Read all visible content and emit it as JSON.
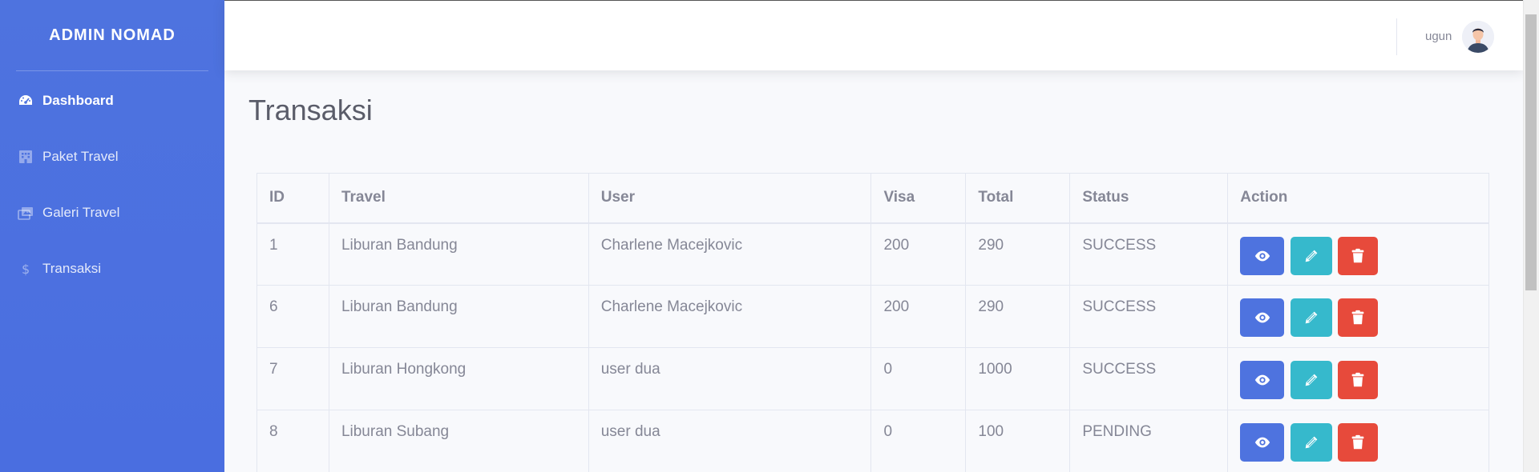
{
  "sidebar": {
    "brand": "ADMIN NOMAD",
    "items": [
      {
        "label": "Dashboard",
        "icon": "tachometer-icon",
        "active": true
      },
      {
        "label": "Paket Travel",
        "icon": "hotel-icon",
        "active": false
      },
      {
        "label": "Galeri Travel",
        "icon": "images-icon",
        "active": false
      },
      {
        "label": "Transaksi",
        "icon": "dollar-icon",
        "active": false
      }
    ]
  },
  "topbar": {
    "username": "ugun"
  },
  "main": {
    "title": "Transaksi",
    "table": {
      "headers": [
        "ID",
        "Travel",
        "User",
        "Visa",
        "Total",
        "Status",
        "Action"
      ],
      "rows": [
        {
          "id": "1",
          "travel": "Liburan Bandung",
          "user": "Charlene Macejkovic",
          "visa": "200",
          "total": "290",
          "status": "SUCCESS"
        },
        {
          "id": "6",
          "travel": "Liburan Bandung",
          "user": "Charlene Macejkovic",
          "visa": "200",
          "total": "290",
          "status": "SUCCESS"
        },
        {
          "id": "7",
          "travel": "Liburan Hongkong",
          "user": "user dua",
          "visa": "0",
          "total": "1000",
          "status": "SUCCESS"
        },
        {
          "id": "8",
          "travel": "Liburan Subang",
          "user": "user dua",
          "visa": "0",
          "total": "100",
          "status": "PENDING"
        }
      ]
    }
  },
  "colors": {
    "primary": "#4e73df",
    "info": "#36b9cc",
    "danger": "#e74a3b",
    "text": "#858796"
  }
}
